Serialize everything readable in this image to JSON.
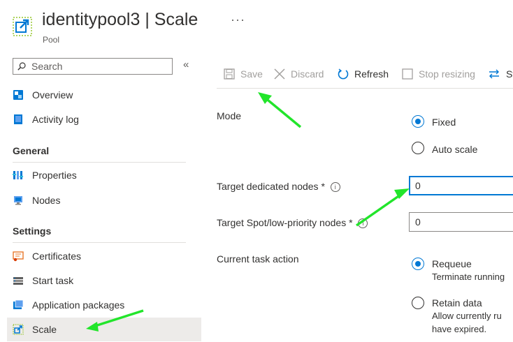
{
  "header": {
    "resource_name": "identitypool3",
    "separator": "|",
    "page_name": "Scale",
    "subtitle": "Pool",
    "more_label": "···"
  },
  "sidebar": {
    "search_placeholder": "Search",
    "collapse_glyph": "«",
    "items_top": [
      {
        "label": "Overview",
        "icon": "overview-icon"
      },
      {
        "label": "Activity log",
        "icon": "activity-log-icon"
      }
    ],
    "sections": [
      {
        "title": "General",
        "items": [
          {
            "label": "Properties",
            "icon": "properties-icon"
          },
          {
            "label": "Nodes",
            "icon": "nodes-icon"
          }
        ]
      },
      {
        "title": "Settings",
        "items": [
          {
            "label": "Certificates",
            "icon": "certificates-icon"
          },
          {
            "label": "Start task",
            "icon": "start-task-icon"
          },
          {
            "label": "Application packages",
            "icon": "application-packages-icon"
          },
          {
            "label": "Scale",
            "icon": "scale-icon",
            "active": true
          }
        ]
      }
    ]
  },
  "toolbar": {
    "save": "Save",
    "discard": "Discard",
    "refresh": "Refresh",
    "stop_resizing": "Stop resizing",
    "switch_partial": "Sv"
  },
  "form": {
    "mode_label": "Mode",
    "mode_options": [
      "Fixed",
      "Auto scale"
    ],
    "mode_selected": "Fixed",
    "target_dedicated_label": "Target dedicated nodes",
    "target_dedicated_value": "0",
    "target_spot_label": "Target Spot/low-priority nodes",
    "target_spot_value": "0",
    "required_mark": "*",
    "info_glyph": "i",
    "task_action_label": "Current task action",
    "task_options": [
      {
        "label": "Requeue",
        "desc": [
          "Terminate running"
        ]
      },
      {
        "label": "Retain data",
        "desc": [
          "Allow currently ru",
          "have expired."
        ]
      }
    ],
    "task_selected": "Requeue"
  },
  "colors": {
    "accent": "#0078d4",
    "annotation_arrow": "#22e52b",
    "disabled_text": "#a19f9d",
    "active_nav_bg": "#edebe9"
  }
}
